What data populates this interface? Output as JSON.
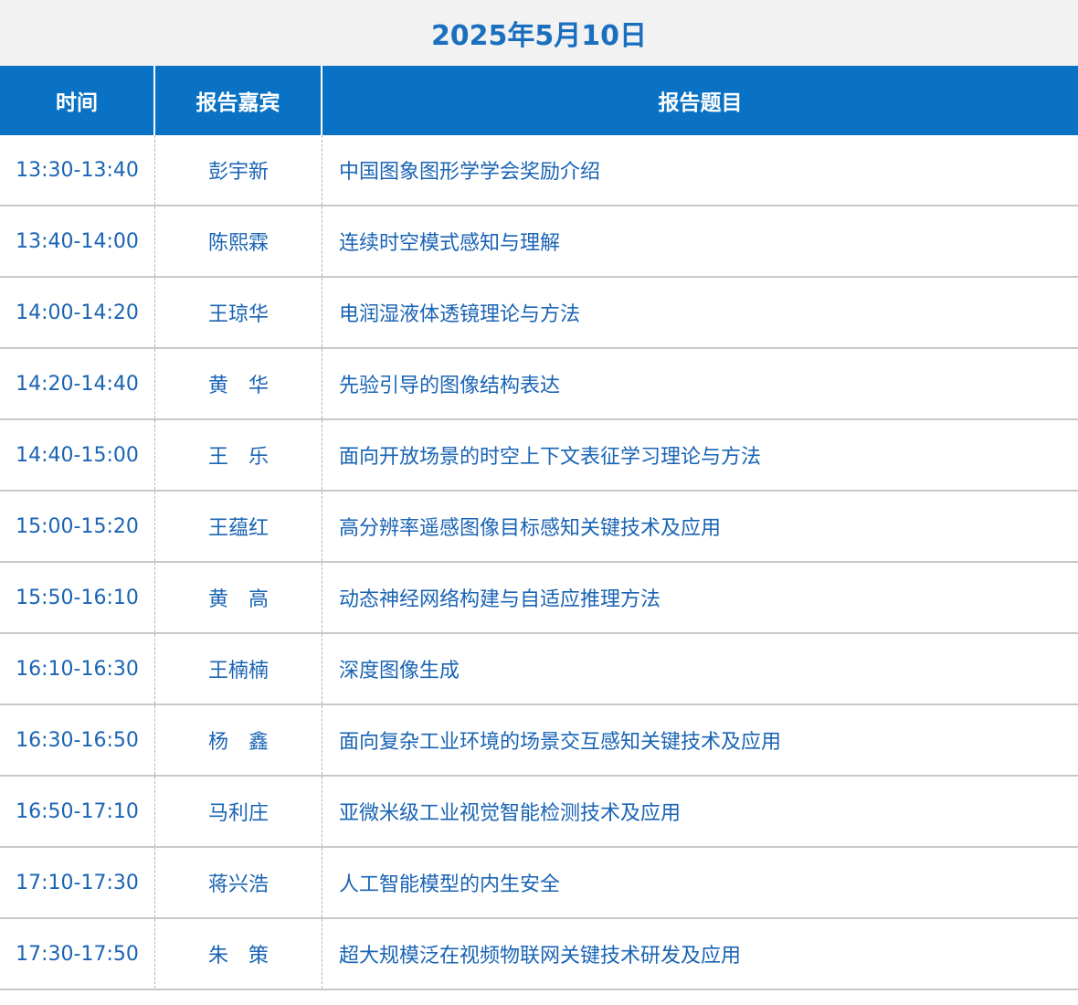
{
  "date_title": "2025年5月10日",
  "columns": {
    "time": "时间",
    "speaker": "报告嘉宾",
    "topic": "报告题目"
  },
  "rows": [
    {
      "time": "13:30-13:40",
      "speaker": "彭宇新",
      "topic": "中国图象图形学学会奖励介绍"
    },
    {
      "time": "13:40-14:00",
      "speaker": "陈熙霖",
      "topic": "连续时空模式感知与理解"
    },
    {
      "time": "14:00-14:20",
      "speaker": "王琼华",
      "topic": "电润湿液体透镜理论与方法"
    },
    {
      "time": "14:20-14:40",
      "speaker": "黄　华",
      "topic": "先验引导的图像结构表达"
    },
    {
      "time": "14:40-15:00",
      "speaker": "王　乐",
      "topic": "面向开放场景的时空上下文表征学习理论与方法"
    },
    {
      "time": "15:00-15:20",
      "speaker": "王蕴红",
      "topic": "高分辨率遥感图像目标感知关键技术及应用"
    },
    {
      "time": "15:50-16:10",
      "speaker": "黄　高",
      "topic": "动态神经网络构建与自适应推理方法"
    },
    {
      "time": "16:10-16:30",
      "speaker": "王楠楠",
      "topic": "深度图像生成"
    },
    {
      "time": "16:30-16:50",
      "speaker": "杨　鑫",
      "topic": "面向复杂工业环境的场景交互感知关键技术及应用"
    },
    {
      "time": "16:50-17:10",
      "speaker": "马利庄",
      "topic": "亚微米级工业视觉智能检测技术及应用"
    },
    {
      "time": "17:10-17:30",
      "speaker": "蒋兴浩",
      "topic": "人工智能模型的内生安全"
    },
    {
      "time": "17:30-17:50",
      "speaker": "朱　策",
      "topic": "超大规模泛在视频物联网关键技术研发及应用"
    }
  ],
  "colors": {
    "header_bg": "#0a72c4",
    "date_text": "#1a6fbf",
    "row_text": "#1a64b4",
    "date_bg": "#f2f2f2"
  }
}
